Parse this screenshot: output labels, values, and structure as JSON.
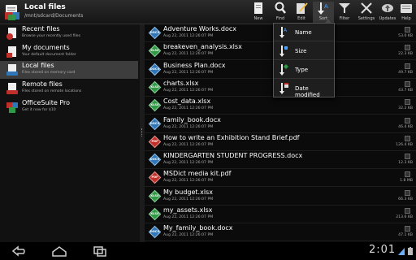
{
  "header": {
    "title": "Local files",
    "path": "/mnt/sdcard/Documents",
    "actions": [
      {
        "label": "New",
        "icon": "new-document-icon"
      },
      {
        "label": "Find",
        "icon": "magnifier-icon"
      },
      {
        "label": "Edit",
        "icon": "edit-icon"
      },
      {
        "label": "Sort",
        "icon": "sort-icon"
      },
      {
        "label": "Filter",
        "icon": "filter-icon"
      },
      {
        "label": "Settings",
        "icon": "settings-icon"
      },
      {
        "label": "Updates",
        "icon": "updates-icon"
      },
      {
        "label": "Help",
        "icon": "help-icon"
      }
    ]
  },
  "sidebar": {
    "items": [
      {
        "title": "Recent files",
        "subtitle": "Browse your recently used files",
        "icon": "recent-files-icon"
      },
      {
        "title": "My documents",
        "subtitle": "Your default document folder",
        "icon": "my-documents-icon"
      },
      {
        "title": "Local files",
        "subtitle": "Files stored on memory card",
        "icon": "local-files-icon"
      },
      {
        "title": "Remote files",
        "subtitle": "Files stored on remote locations",
        "icon": "remote-files-icon"
      },
      {
        "title": "OfficeSuite Pro",
        "subtitle": "Get it now for $10",
        "icon": "officesuite-logo-icon"
      }
    ]
  },
  "files": [
    {
      "name": "Adventure Works.docx",
      "date": "Aug 22, 2011 12:26:07 PM",
      "size": "53.0 KB",
      "type": "DOCX",
      "color": "#2f77b8"
    },
    {
      "name": "breakeven_analysis.xlsx",
      "date": "Aug 22, 2011 12:26:07 PM",
      "size": "22.3 KB",
      "type": "XLSX",
      "color": "#2e9a44"
    },
    {
      "name": "Business Plan.docx",
      "date": "Aug 22, 2011 12:26:07 PM",
      "size": "49.7 KB",
      "type": "DOCX",
      "color": "#2f77b8"
    },
    {
      "name": "charts.xlsx",
      "date": "Aug 22, 2011 12:26:07 PM",
      "size": "43.7 KB",
      "type": "XLSX",
      "color": "#2e9a44"
    },
    {
      "name": "Cost_data.xlsx",
      "date": "Aug 22, 2011 12:26:07 PM",
      "size": "32.2 KB",
      "type": "XLSX",
      "color": "#2e9a44"
    },
    {
      "name": "Family_book.docx",
      "date": "Aug 22, 2011 12:26:07 PM",
      "size": "46.4 KB",
      "type": "DOCX",
      "color": "#2f77b8"
    },
    {
      "name": "How to write an Exhibition Stand Brief.pdf",
      "date": "Aug 22, 2011 12:26:07 PM",
      "size": "126.4 KB",
      "type": "PDF",
      "color": "#c0302a"
    },
    {
      "name": "KINDERGARTEN STUDENT PROGRESS.docx",
      "date": "Aug 22, 2011 12:26:07 PM",
      "size": "12.3 KB",
      "type": "DOCX",
      "color": "#2f77b8"
    },
    {
      "name": "MSDict media kit.pdf",
      "date": "Aug 22, 2011 12:26:07 PM",
      "size": "1.8 MB",
      "type": "PDF",
      "color": "#c0302a"
    },
    {
      "name": "My budget.xlsx",
      "date": "Aug 22, 2011 12:26:07 PM",
      "size": "66.3 KB",
      "type": "XLSX",
      "color": "#2e9a44"
    },
    {
      "name": "my_assets.xlsx",
      "date": "Aug 22, 2011 12:26:07 PM",
      "size": "213.6 KB",
      "type": "XLSX",
      "color": "#2e9a44"
    },
    {
      "name": "My_family_book.docx",
      "date": "Aug 22, 2011 12:26:07 PM",
      "size": "47.1 KB",
      "type": "DOCX",
      "color": "#2f77b8"
    }
  ],
  "sort_menu": {
    "options": [
      {
        "label": "Name",
        "icon": "sort-name-icon"
      },
      {
        "label": "Size",
        "icon": "sort-size-icon"
      },
      {
        "label": "Type",
        "icon": "sort-type-icon"
      },
      {
        "label": "Date modified",
        "icon": "sort-date-icon"
      }
    ]
  },
  "system_bar": {
    "clock": "2:01",
    "buttons": [
      "back-icon",
      "home-icon",
      "recent-apps-icon"
    ]
  }
}
